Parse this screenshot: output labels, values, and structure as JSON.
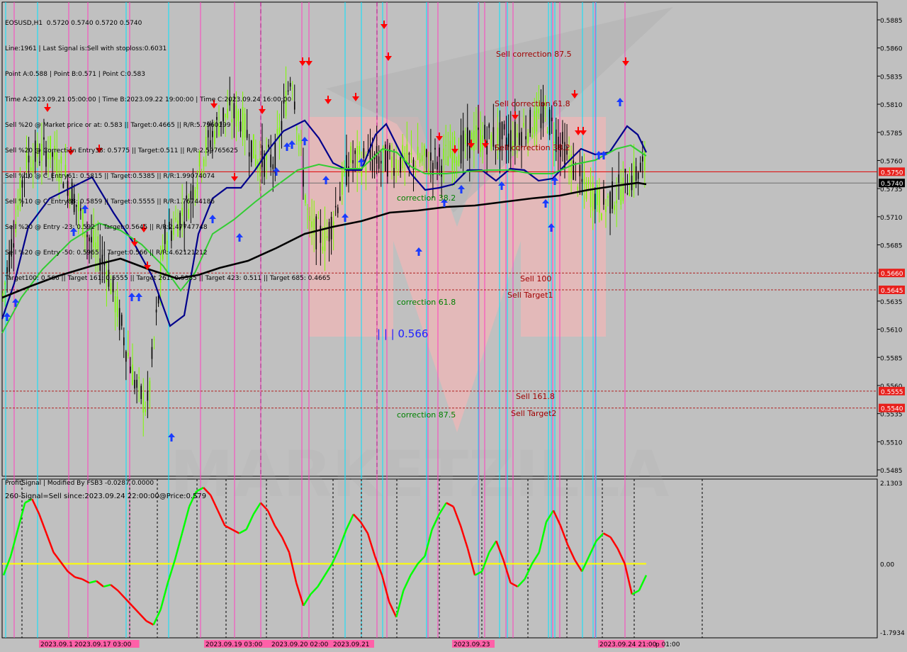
{
  "header": {
    "lines": [
      "EOSUSD,H1  0.5720 0.5740 0.5720 0.5740",
      "Line:1961 | Last Signal is:Sell with stoploss:0.6031",
      "Point A:0.588 | Point B:0.571 | Point C:0.583",
      "Time A:2023.09.21 05:00:00 | Time B:2023.09.22 19:00:00 | Time C:2023.09.24 16:00:00",
      "Sell %20 @ Market price or at: 0.583 || Target:0.4665 || R/R:5.7960199",
      "Sell %20 @ Correction Entry38: 0.5775 || Target:0.511 || R/R:2.59765625",
      "Sell %10 @ C_Entry61: 0.5815 || Target:0.5385 || R/R:1.99074074",
      "Sell %10 @ C_Entry88: 0.5859 || Target:0.5555 || R/R:1.76744186",
      "Sell %20 @ Entry -23: 0.592 || Target:0.5645 || R/R:2.47747748",
      "Sell %20 @ Entry -50: 0.5965 || Target:0.566 || R/R:4.62121212",
      "Target100: 0.566 || Target 161: 0.5555 || Target 261: 0.5385 || Target 423: 0.511 || Target 685: 0.4665"
    ]
  },
  "subwindow": {
    "title": "ProfitSignal | Modified By FSB3 -0.0287 0.0000",
    "signal_text": "260-Signal=Sell since:2023.09.24 22:00:00@Price:0.579"
  },
  "colors": {
    "background": "#c0c0c0",
    "bull_candle": "#7cfc00",
    "bear_candle": "#000000",
    "ma_blue": "#00008b",
    "ma_green": "#32cd32",
    "ma_black": "#000000",
    "red_line": "#e00000",
    "price_badge": "#e8201c",
    "pink_vline": "#ff40c0",
    "cyan_vline": "#00e5ff",
    "osc_up": "#00ff00",
    "osc_down": "#ff0000",
    "zero_line": "#ffff00",
    "watermark": "#ffb3b3"
  },
  "chart_data": {
    "type": "candlestick",
    "symbol": "EOSUSD,H1",
    "ylim": [
      0.5475,
      0.5895
    ],
    "y_ticks": [
      "0.5885",
      "0.5860",
      "0.5835",
      "0.5810",
      "0.5785",
      "0.5760",
      "0.5735",
      "0.5710",
      "0.5685",
      "0.5660",
      "0.5635",
      "0.5610",
      "0.5585",
      "0.5560",
      "0.5535",
      "0.5510",
      "0.5485"
    ],
    "price_levels": [
      {
        "value": 0.575,
        "label": "0.5750",
        "style": "solid-red"
      },
      {
        "value": 0.574,
        "label": "0.5740",
        "style": "current"
      },
      {
        "value": 0.566,
        "label": "0.5660",
        "style": "dashed"
      },
      {
        "value": 0.5645,
        "label": "0.5645",
        "style": "dashed"
      },
      {
        "value": 0.5555,
        "label": "0.5555",
        "style": "dashed"
      },
      {
        "value": 0.554,
        "label": "0.5540",
        "style": "dashed"
      }
    ],
    "annotations": [
      {
        "text": "Sell correction 87.5",
        "color": "#a00000"
      },
      {
        "text": "Sell correction 61.8",
        "color": "#a00000"
      },
      {
        "text": "Sell correction 38.2",
        "color": "#a00000"
      },
      {
        "text": "correction 38.2",
        "color": "#008000"
      },
      {
        "text": "Sell 100",
        "color": "#a00000"
      },
      {
        "text": "Sell Target1",
        "color": "#a00000"
      },
      {
        "text": "correction 61.8",
        "color": "#008000"
      },
      {
        "text": "| | | 0.566",
        "color": "#2020ff"
      },
      {
        "text": "Sell 161.8",
        "color": "#a00000"
      },
      {
        "text": "Sell Target2",
        "color": "#a00000"
      },
      {
        "text": "correction 87.5",
        "color": "#008000"
      }
    ],
    "x_labels": [
      "2023.09.16 16:00",
      "2023.09.17 03:00",
      "2023.09.19 03:00",
      "2023.09.20 02:00",
      "2023.09.21",
      "2023.09.23",
      "2023.09.24 21:00",
      "p 01:00"
    ],
    "oscillator": {
      "y_ticks": [
        "2.1303",
        "0.00",
        "-1.7934"
      ],
      "ylim": [
        -1.7934,
        2.1303
      ],
      "values": [
        -0.3,
        0.2,
        0.9,
        1.6,
        1.7,
        1.3,
        0.8,
        0.3,
        0.05,
        -0.2,
        -0.35,
        -0.4,
        -0.5,
        -0.45,
        -0.6,
        -0.55,
        -0.7,
        -0.9,
        -1.1,
        -1.3,
        -1.5,
        -1.6,
        -1.2,
        -0.5,
        0.1,
        0.8,
        1.5,
        1.9,
        2.0,
        1.8,
        1.4,
        1.0,
        0.9,
        0.8,
        0.9,
        1.3,
        1.6,
        1.4,
        1.0,
        0.7,
        0.3,
        -0.5,
        -1.1,
        -0.8,
        -0.6,
        -0.3,
        0.0,
        0.4,
        0.9,
        1.3,
        1.1,
        0.8,
        0.2,
        -0.3,
        -1.0,
        -1.4,
        -0.7,
        -0.3,
        0.0,
        0.2,
        0.9,
        1.3,
        1.6,
        1.5,
        1.0,
        0.4,
        -0.3,
        -0.2,
        0.3,
        0.6,
        0.1,
        -0.5,
        -0.6,
        -0.4,
        0.0,
        0.3,
        1.1,
        1.4,
        1.0,
        0.5,
        0.1,
        -0.2,
        0.2,
        0.6,
        0.8,
        0.7,
        0.4,
        0.0,
        -0.8,
        -0.7,
        -0.3
      ]
    }
  }
}
